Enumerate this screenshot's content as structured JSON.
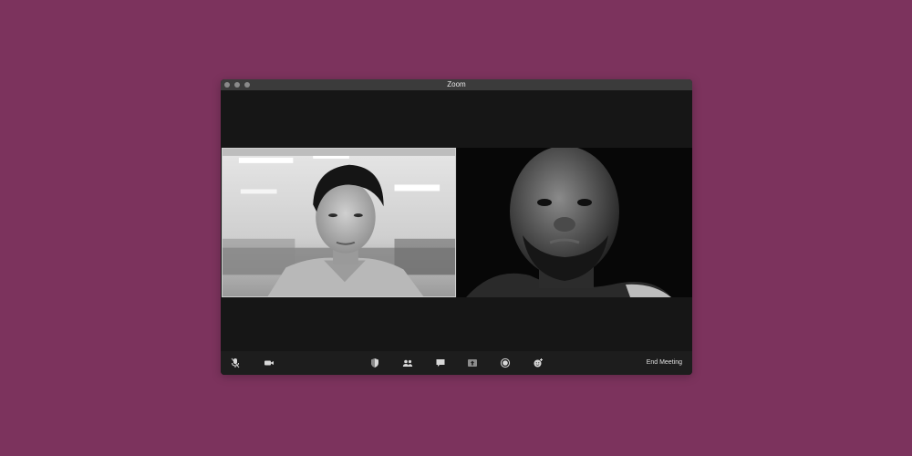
{
  "window": {
    "title": "Zoom"
  },
  "participants": [
    {
      "description": "young man with dark hair in an office",
      "tile": "left"
    },
    {
      "description": "bald man with beard in dark room",
      "tile": "right"
    }
  ],
  "toolbar": {
    "left_icons": [
      "mute-icon",
      "video-camera-icon"
    ],
    "center_icons": [
      "security-shield-icon",
      "participants-icon",
      "chat-icon",
      "share-screen-icon",
      "record-icon",
      "reactions-icon"
    ],
    "end_meeting_label": "End Meeting"
  },
  "colors": {
    "background": "#7c335d",
    "window": "#161616",
    "titlebar": "#3b3b3b",
    "toolbar": "#1d1d1d"
  }
}
